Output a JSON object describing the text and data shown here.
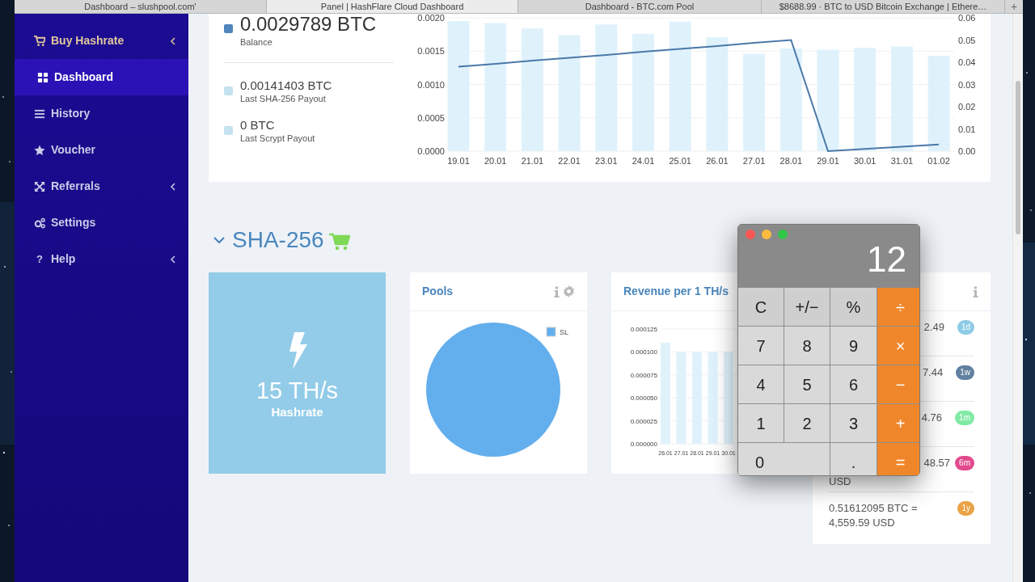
{
  "browser_tabs": [
    {
      "title": "Dashboard – slushpool.com'",
      "selected": false
    },
    {
      "title": "Panel | HashFlare Cloud Dashboard",
      "selected": true
    },
    {
      "title": "Dashboard - BTC.com Pool",
      "selected": false
    },
    {
      "title": "$8688.99 · BTC to USD Bitcoin Exchange | Ethere…",
      "selected": false
    }
  ],
  "new_tab_button": "+",
  "sidebar": {
    "items": [
      {
        "label": "Buy Hashrate",
        "highlight": true,
        "selected": false,
        "has_submenu": true
      },
      {
        "label": "Dashboard",
        "highlight": false,
        "selected": true,
        "has_submenu": false
      },
      {
        "label": "History",
        "highlight": false,
        "selected": false,
        "has_submenu": false
      },
      {
        "label": "Voucher",
        "highlight": false,
        "selected": false,
        "has_submenu": false
      },
      {
        "label": "Referrals",
        "highlight": false,
        "selected": false,
        "has_submenu": true
      },
      {
        "label": "Settings",
        "highlight": false,
        "selected": false,
        "has_submenu": false
      },
      {
        "label": "Help",
        "icon_char": "?",
        "highlight": false,
        "selected": false,
        "has_submenu": true
      }
    ]
  },
  "summary": {
    "stats": [
      {
        "value": "0.0029789 BTC",
        "label": "Balance",
        "color": "#4f86bd",
        "kind": "main"
      },
      {
        "value": "0.00141403 BTC",
        "label": "Last SHA-256 Payout",
        "color": "#c4e2ef",
        "kind": "minor"
      },
      {
        "value": "0 BTC",
        "label": "Last Scrypt Payout",
        "color": "#c4e2ef",
        "kind": "minor"
      }
    ],
    "chart_data": {
      "type": "bar",
      "grid": true,
      "categories": [
        "19.01",
        "20.01",
        "21.01",
        "22.01",
        "23.01",
        "24.01",
        "25.01",
        "26.01",
        "27.01",
        "28.01",
        "29.01",
        "30.01",
        "31.01",
        "01.02"
      ],
      "series": [
        {
          "color": "#dff2fc",
          "values": [
            0.00195,
            0.00192,
            0.00184,
            0.00174,
            0.0019,
            0.00176,
            0.00194,
            0.00171,
            0.00146,
            0.00154,
            0.00152,
            0.00155,
            0.00157,
            0.00143
          ]
        },
        {
          "type": "line",
          "axis": "y2",
          "color": "#4a78a8",
          "values": [
            0.038,
            0.0393,
            0.0407,
            0.042,
            0.0433,
            0.0447,
            0.046,
            0.0473,
            0.0487,
            0.05,
            0,
            0.001,
            0.002,
            0.003
          ]
        }
      ],
      "ylim": [
        0,
        0.002
      ],
      "yticks": [
        {
          "value": 0,
          "label": "0.0000"
        },
        {
          "value": 0.0005,
          "label": "0.0005"
        },
        {
          "value": 0.001,
          "label": "0.0010"
        },
        {
          "value": 0.0015,
          "label": "0.0015"
        },
        {
          "value": 0.002,
          "label": "0.0020"
        }
      ],
      "y2lim": [
        0,
        0.06
      ],
      "y2ticks": [
        {
          "value": 0,
          "label": "0.00"
        },
        {
          "value": 0.01,
          "label": "0.01"
        },
        {
          "value": 0.02,
          "label": "0.02"
        },
        {
          "value": 0.03,
          "label": "0.03"
        },
        {
          "value": 0.04,
          "label": "0.04"
        },
        {
          "value": 0.05,
          "label": "0.05"
        },
        {
          "value": 0.06,
          "label": "0.06"
        }
      ]
    }
  },
  "section": {
    "title": "SHA-256",
    "expanded": true
  },
  "hashrate_tile": {
    "value": "15 TH/s",
    "label": "Hashrate"
  },
  "pools_card": {
    "title": "Pools",
    "chart_data": {
      "type": "pie",
      "categories": [
        "SL"
      ],
      "series": [
        {
          "color": "#63aeed",
          "values": [
            100
          ]
        }
      ]
    }
  },
  "revenue_card": {
    "title": "Revenue per 1 TH/s",
    "chart_data": {
      "type": "bar",
      "categories": [
        "26.01",
        "27.01",
        "28.01",
        "29.01",
        "30.01"
      ],
      "series": [
        {
          "color": "#dff2fc",
          "values": [
            0.00011,
            0.0001,
            0.0001,
            0.0001,
            0.0001
          ]
        }
      ],
      "grid": true,
      "ylim": [
        0,
        0.000125
      ],
      "yticks": [
        {
          "value": 0,
          "label": "0.000000"
        },
        {
          "value": 2.5e-05,
          "label": "0.000025"
        },
        {
          "value": 5e-05,
          "label": "0.000050"
        },
        {
          "value": 7.5e-05,
          "label": "0.000075"
        },
        {
          "value": 0.0001,
          "label": "0.000100"
        },
        {
          "value": 0.000125,
          "label": "0.000125"
        }
      ]
    }
  },
  "returns_card": {
    "rows": [
      {
        "lines": [
          "2.49"
        ],
        "partly_covered": true,
        "badge": "1d",
        "color": "#8ecbe6"
      },
      {
        "lines": [
          "7.44"
        ],
        "partly_covered": true,
        "badge": "1w",
        "color": "#62809f"
      },
      {
        "lines": [
          "4.76"
        ],
        "partly_covered": true,
        "badge": "1m",
        "color": "#80eaa4"
      },
      {
        "lines": [
          "48.57",
          "USD"
        ],
        "partly_covered": true,
        "badge": "6m",
        "color": "#e24a8d"
      },
      {
        "lines": [
          "0.51612095 BTC =",
          "4,559.59 USD"
        ],
        "partly_covered": false,
        "badge": "1y",
        "color": "#e9a244"
      }
    ]
  },
  "calculator": {
    "display": "12",
    "keys": [
      {
        "label": "C",
        "kind": "function",
        "wide": false
      },
      {
        "label": "+/−",
        "kind": "function",
        "wide": false
      },
      {
        "label": "%",
        "kind": "function",
        "wide": false
      },
      {
        "label": "÷",
        "kind": "operator",
        "wide": false
      },
      {
        "label": "7",
        "kind": "digit",
        "wide": false
      },
      {
        "label": "8",
        "kind": "digit",
        "wide": false
      },
      {
        "label": "9",
        "kind": "digit",
        "wide": false
      },
      {
        "label": "×",
        "kind": "operator",
        "wide": false
      },
      {
        "label": "4",
        "kind": "digit",
        "wide": false
      },
      {
        "label": "5",
        "kind": "digit",
        "wide": false
      },
      {
        "label": "6",
        "kind": "digit",
        "wide": false
      },
      {
        "label": "−",
        "kind": "operator",
        "wide": false
      },
      {
        "label": "1",
        "kind": "digit",
        "wide": false
      },
      {
        "label": "2",
        "kind": "digit",
        "wide": false
      },
      {
        "label": "3",
        "kind": "digit",
        "wide": false
      },
      {
        "label": "+",
        "kind": "operator",
        "wide": false
      },
      {
        "label": "0",
        "kind": "digit",
        "wide": true
      },
      {
        "label": ".",
        "kind": "digit",
        "wide": false
      },
      {
        "label": "=",
        "kind": "operator",
        "wide": false
      }
    ]
  }
}
